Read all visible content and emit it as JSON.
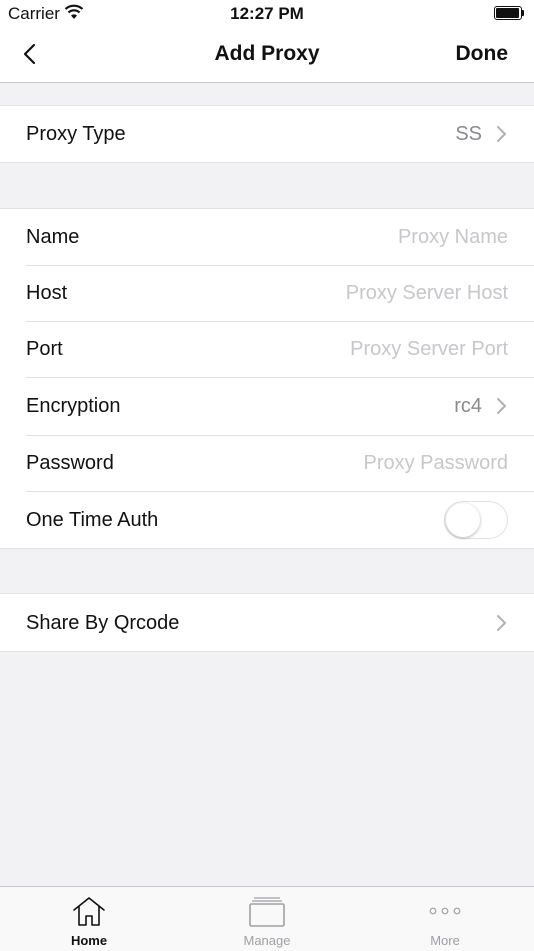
{
  "status_bar": {
    "carrier": "Carrier",
    "time": "12:27 PM"
  },
  "nav": {
    "title": "Add Proxy",
    "done_label": "Done",
    "back_icon": "chevron-left-icon"
  },
  "proxy_type": {
    "label": "Proxy Type",
    "value": "SS"
  },
  "fields": {
    "name": {
      "label": "Name",
      "placeholder": "Proxy Name",
      "value": ""
    },
    "host": {
      "label": "Host",
      "placeholder": "Proxy Server Host",
      "value": ""
    },
    "port": {
      "label": "Port",
      "placeholder": "Proxy Server Port",
      "value": ""
    },
    "encryption": {
      "label": "Encryption",
      "value": "rc4"
    },
    "password": {
      "label": "Password",
      "placeholder": "Proxy Password",
      "value": ""
    },
    "one_time_auth": {
      "label": "One Time Auth",
      "enabled": false
    }
  },
  "share": {
    "label": "Share By Qrcode"
  },
  "tabs": [
    {
      "label": "Home",
      "icon": "home-icon",
      "active": true
    },
    {
      "label": "Manage",
      "icon": "stack-icon",
      "active": false
    },
    {
      "label": "More",
      "icon": "more-dots-icon",
      "active": false
    }
  ],
  "colors": {
    "active_tab": "#111111",
    "inactive_tab": "#a0a0a4",
    "background": "#f2f2f4"
  }
}
